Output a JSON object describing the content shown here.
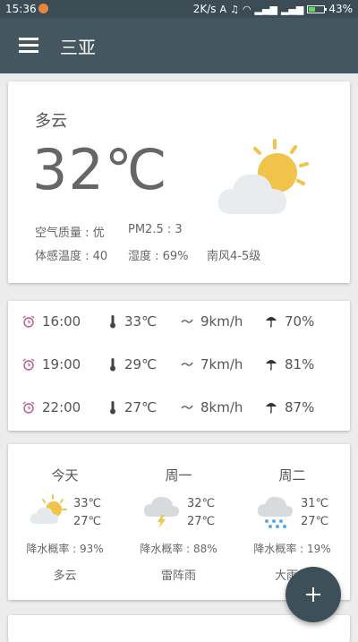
{
  "status_bar": {
    "time": "15:36",
    "network_speed": "2K/s",
    "battery": "43%",
    "battery_level": 0.43
  },
  "app_bar": {
    "title": "三亚"
  },
  "current": {
    "condition": "多云",
    "temperature": "32℃",
    "air_quality": "空气质量 : 优",
    "pm25": "PM2.5 : 3",
    "feels_like": "体感温度 : 40",
    "humidity": "湿度 : 69%",
    "wind": "南风4-5级",
    "icon": "partly-cloudy-icon"
  },
  "hourly": [
    {
      "time": "16:00",
      "temp": "33℃",
      "wind": "9km/h",
      "rain": "70%"
    },
    {
      "time": "19:00",
      "temp": "29℃",
      "wind": "7km/h",
      "rain": "81%"
    },
    {
      "time": "22:00",
      "temp": "27℃",
      "wind": "8km/h",
      "rain": "87%"
    }
  ],
  "daily": [
    {
      "day": "今天",
      "high": "33℃",
      "low": "27℃",
      "rain": "降水概率 : 93%",
      "desc": "多云",
      "icon": "partly-cloudy-icon"
    },
    {
      "day": "周一",
      "high": "32℃",
      "low": "27℃",
      "rain": "降水概率 : 88%",
      "desc": "雷阵雨",
      "icon": "thunderstorm-icon"
    },
    {
      "day": "周二",
      "high": "31℃",
      "low": "27℃",
      "rain": "降水概率 : 19%",
      "desc": "大雨转",
      "icon": "rain-icon"
    }
  ],
  "colors": {
    "toolbar": "#44565f",
    "status_bar": "#3b4c55",
    "sun": "#f0c34a",
    "alarm_icon": "#b4569a",
    "fab": "#3d4f58"
  }
}
